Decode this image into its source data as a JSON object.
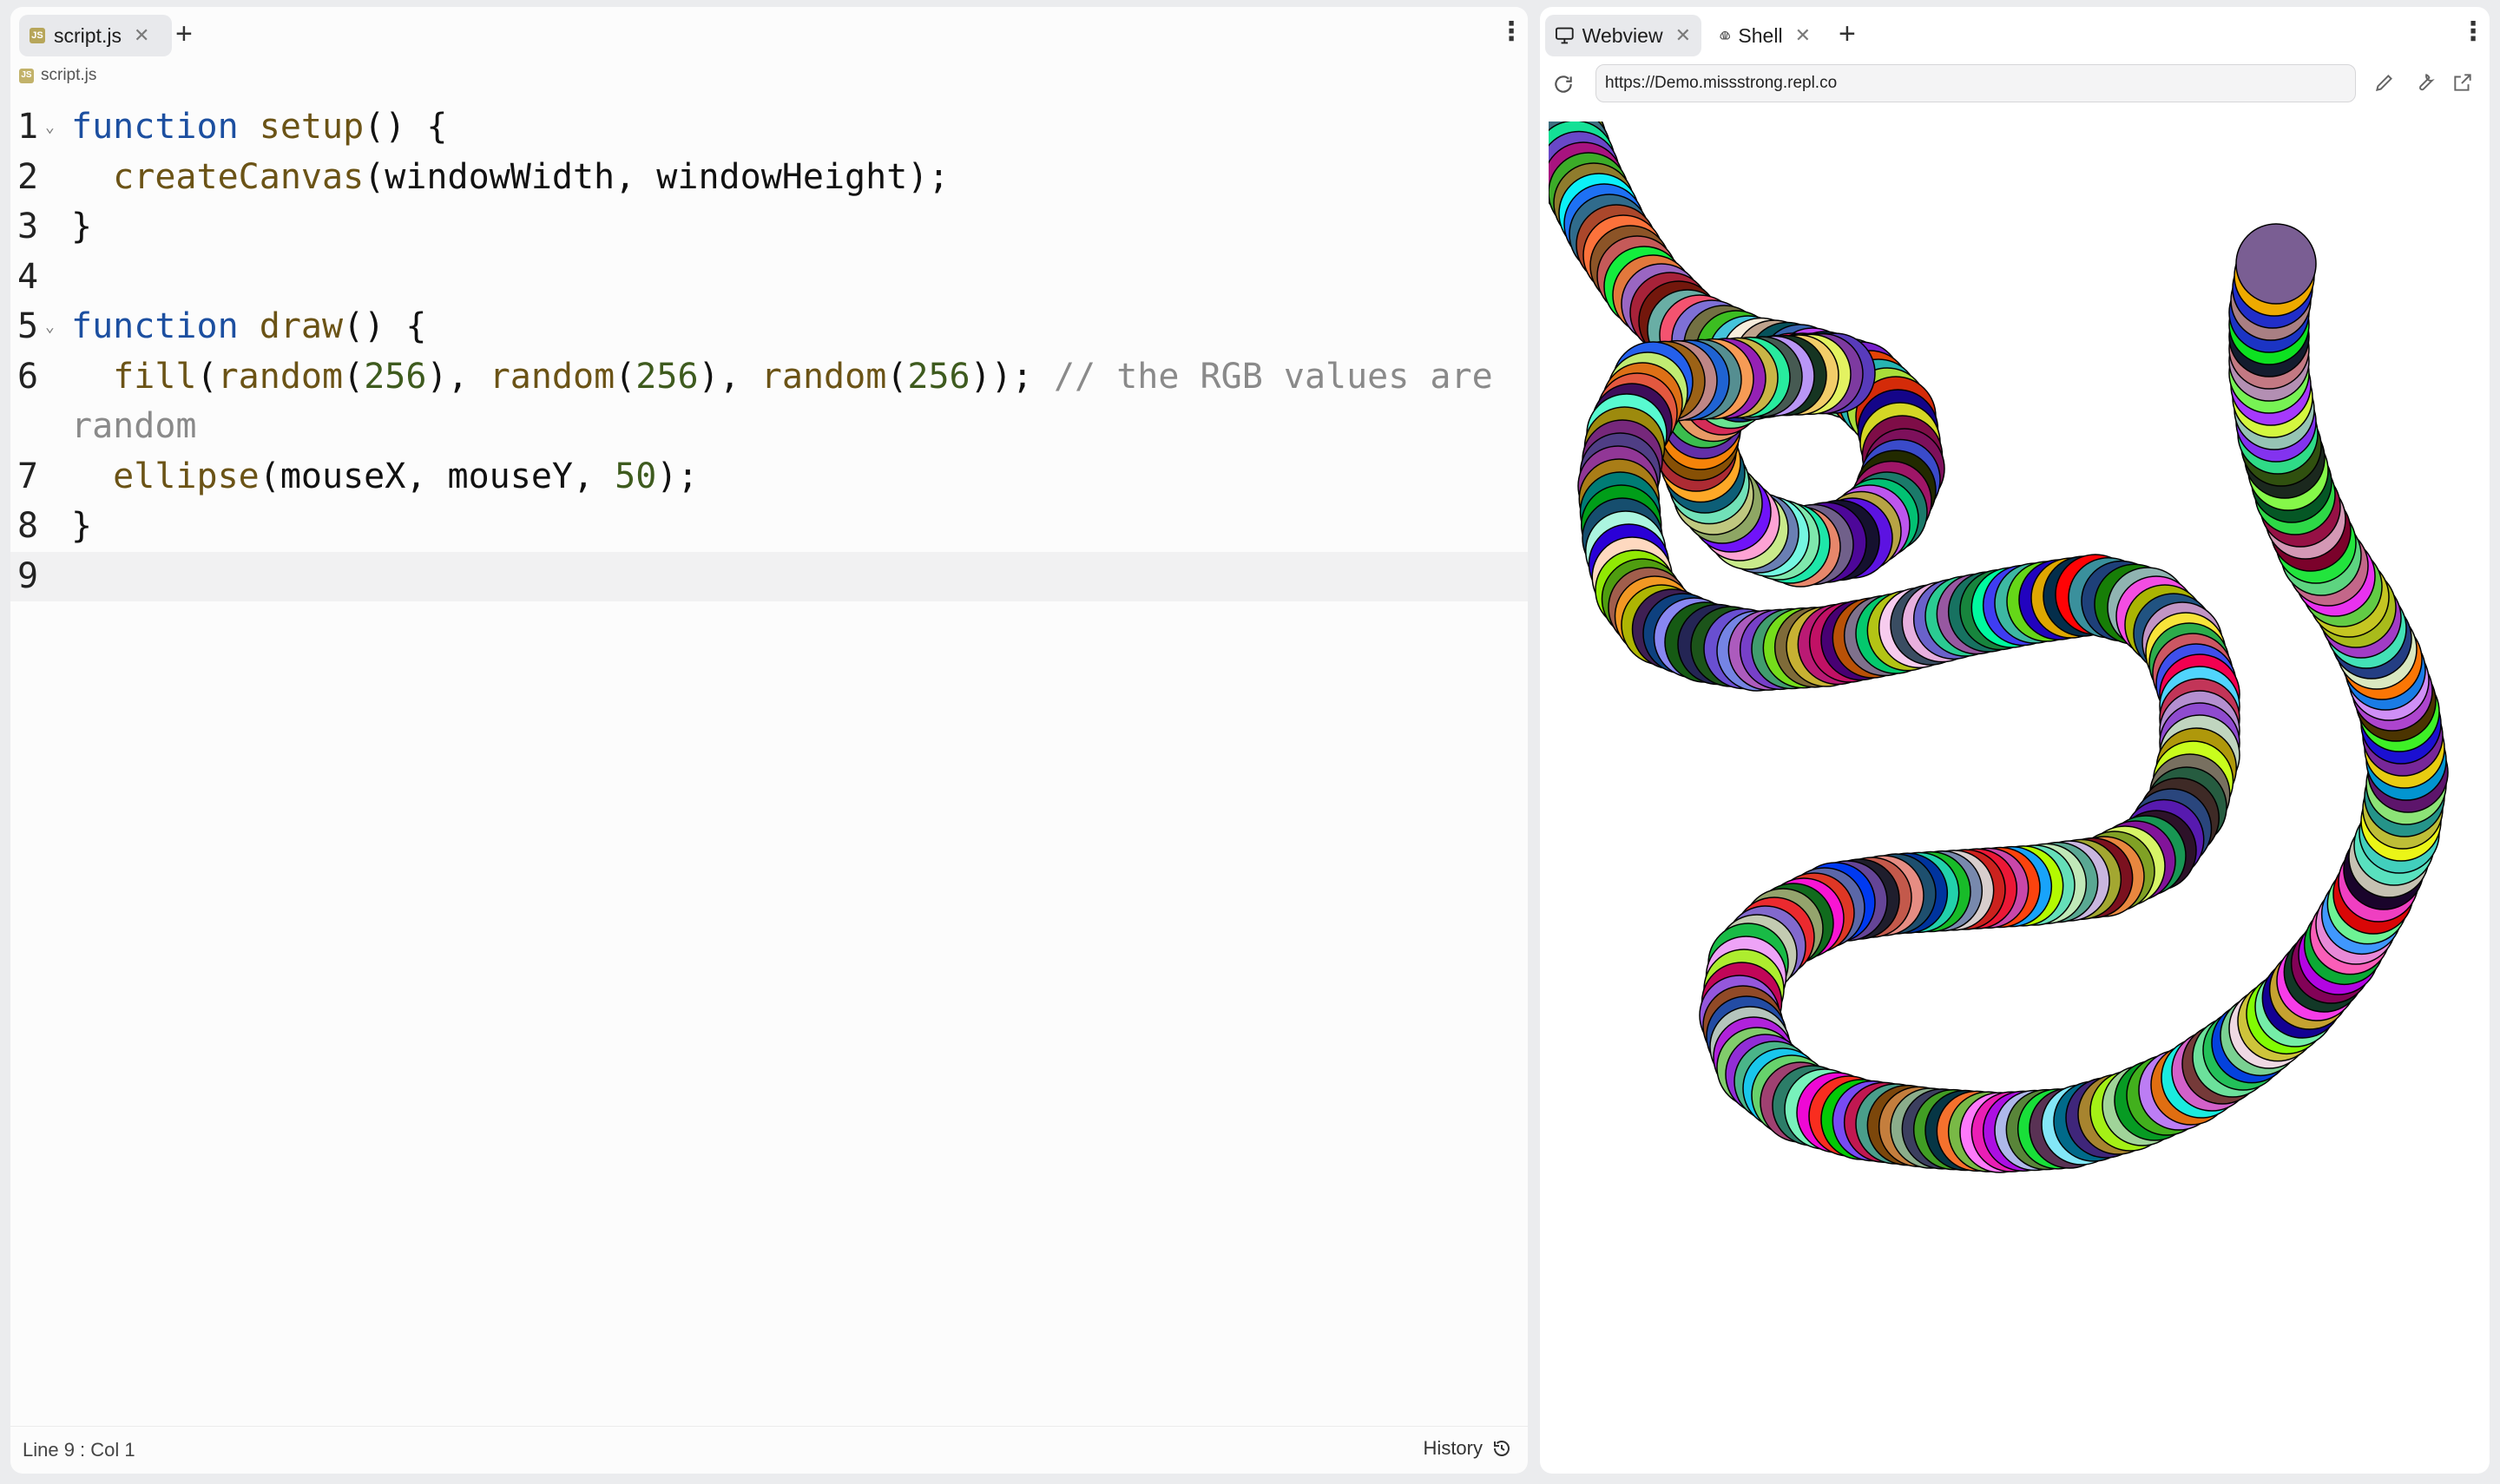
{
  "editor": {
    "tab": {
      "icon": "js-file-icon",
      "badge": "JS",
      "label": "script.js"
    },
    "breadcrumb": {
      "badge": "JS",
      "label": "script.js"
    },
    "lines": [
      {
        "num": "1"
      },
      {
        "num": "2"
      },
      {
        "num": "3"
      },
      {
        "num": "4"
      },
      {
        "num": "5"
      },
      {
        "num": "6"
      },
      {
        "num": "7"
      },
      {
        "num": "8"
      },
      {
        "num": "9"
      }
    ],
    "code": {
      "l1_kw": "function",
      "l1_fn": "setup",
      "l1_rest": "() {",
      "l2_fn": "createCanvas",
      "l2_rest": "(windowWidth, windowHeight);",
      "l3": "}",
      "l5_kw": "function",
      "l5_fn": "draw",
      "l5_rest": "() {",
      "l6_fn1": "fill",
      "l6_p1": "(",
      "l6_fn2": "random",
      "l6_p2": "(",
      "l6_n1": "256",
      "l6_p3": "), ",
      "l6_fn3": "random",
      "l6_p4": "(",
      "l6_n2": "256",
      "l6_p5": "), ",
      "l6_fn4": "random",
      "l6_p6": "(",
      "l6_n3": "256",
      "l6_p7": ")); ",
      "l6_cm": "// the RGB values are random",
      "l7_fn": "ellipse",
      "l7_rest": "(mouseX, mouseY, ",
      "l7_n": "50",
      "l7_end": ");",
      "l8": "}"
    },
    "status": {
      "position": "Line 9 : Col 1",
      "history": "History"
    }
  },
  "webview": {
    "tabs": [
      {
        "label": "Webview"
      },
      {
        "label": "Shell"
      }
    ],
    "url": "https://Demo.missstrong.repl.co"
  },
  "icons": [
    "js-file-icon",
    "close-icon",
    "plus-icon",
    "kebab-menu-icon",
    "monitor-icon",
    "shell-icon",
    "reload-icon",
    "pencil-icon",
    "wrench-icon",
    "external-link-icon",
    "history-icon"
  ],
  "colors": {
    "keyword": "#1c4fa0",
    "function": "#6b5316",
    "number": "#3e5b1e",
    "comment": "#8a8a8a"
  }
}
